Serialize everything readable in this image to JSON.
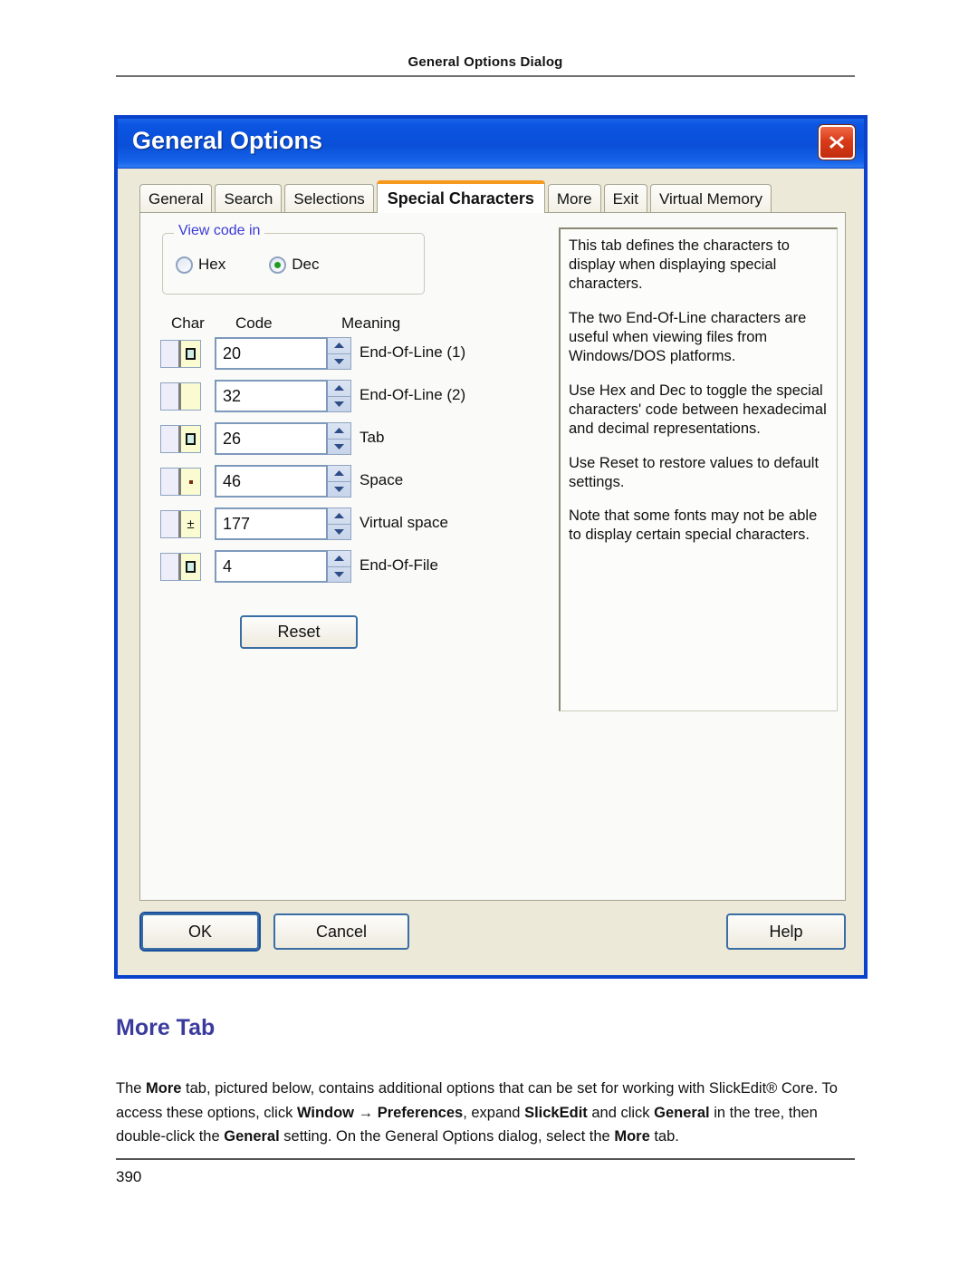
{
  "page": {
    "running_header": "General Options Dialog",
    "page_number": "390"
  },
  "dialog": {
    "title": "General Options",
    "close_icon": "close-x-icon",
    "tabs": [
      {
        "label": "General",
        "active": false
      },
      {
        "label": "Search",
        "active": false
      },
      {
        "label": "Selections",
        "active": false
      },
      {
        "label": "Special Characters",
        "active": true
      },
      {
        "label": "More",
        "active": false
      },
      {
        "label": "Exit",
        "active": false
      },
      {
        "label": "Virtual Memory",
        "active": false
      }
    ],
    "view_code_group": {
      "legend": "View code in",
      "options": [
        {
          "label": "Hex",
          "selected": false
        },
        {
          "label": "Dec",
          "selected": true
        }
      ]
    },
    "table": {
      "headers": {
        "char": "Char",
        "code": "Code",
        "meaning": "Meaning"
      },
      "rows": [
        {
          "glyph": "square",
          "code": "20",
          "meaning": "End-Of-Line (1)"
        },
        {
          "glyph": "blank",
          "code": "32",
          "meaning": "End-Of-Line (2)"
        },
        {
          "glyph": "square",
          "code": "26",
          "meaning": "Tab"
        },
        {
          "glyph": "dot",
          "code": "46",
          "meaning": "Space"
        },
        {
          "glyph": "plusminus",
          "code": "177",
          "meaning": "Virtual space"
        },
        {
          "glyph": "square",
          "code": "4",
          "meaning": "End-Of-File"
        }
      ]
    },
    "reset_label": "Reset",
    "description": [
      "This tab defines the characters to display when displaying special characters.",
      "The two End-Of-Line characters are useful when viewing files from Windows/DOS platforms.",
      "Use Hex and Dec to toggle the special characters' code between hexadecimal and decimal representations.",
      "Use Reset to restore values to default settings.",
      "Note that some fonts may not be able to display certain special characters."
    ],
    "buttons": {
      "ok": "OK",
      "cancel": "Cancel",
      "help": "Help"
    }
  },
  "section": {
    "title": "More Tab",
    "paragraph_html": "The <b>More</b> tab, pictured below, contains additional options that can be set for working with SlickEdit&reg; Core. To access these options, click <b>Window</b> &rarr; <b>Preferences</b>, expand <b>SlickEdit</b> and click <b>General</b> in the tree, then double-click the <b>General</b> setting. On the General Options dialog, select the <b>More</b> tab."
  },
  "colors": {
    "title_bar_blue": "#0a4fd8",
    "dialog_frame_blue": "#0a42cc",
    "dialog_chrome_beige": "#ece9d8",
    "active_tab_orange": "#f59a1f",
    "legend_blue": "#3b3bd6",
    "heading_purple": "#3b3b9e",
    "close_red": "#d83b1a",
    "radio_green": "#1f9c1f",
    "char_cell_yellow": "#fbfbd2",
    "char_cell_lavender": "#eeeefb"
  }
}
